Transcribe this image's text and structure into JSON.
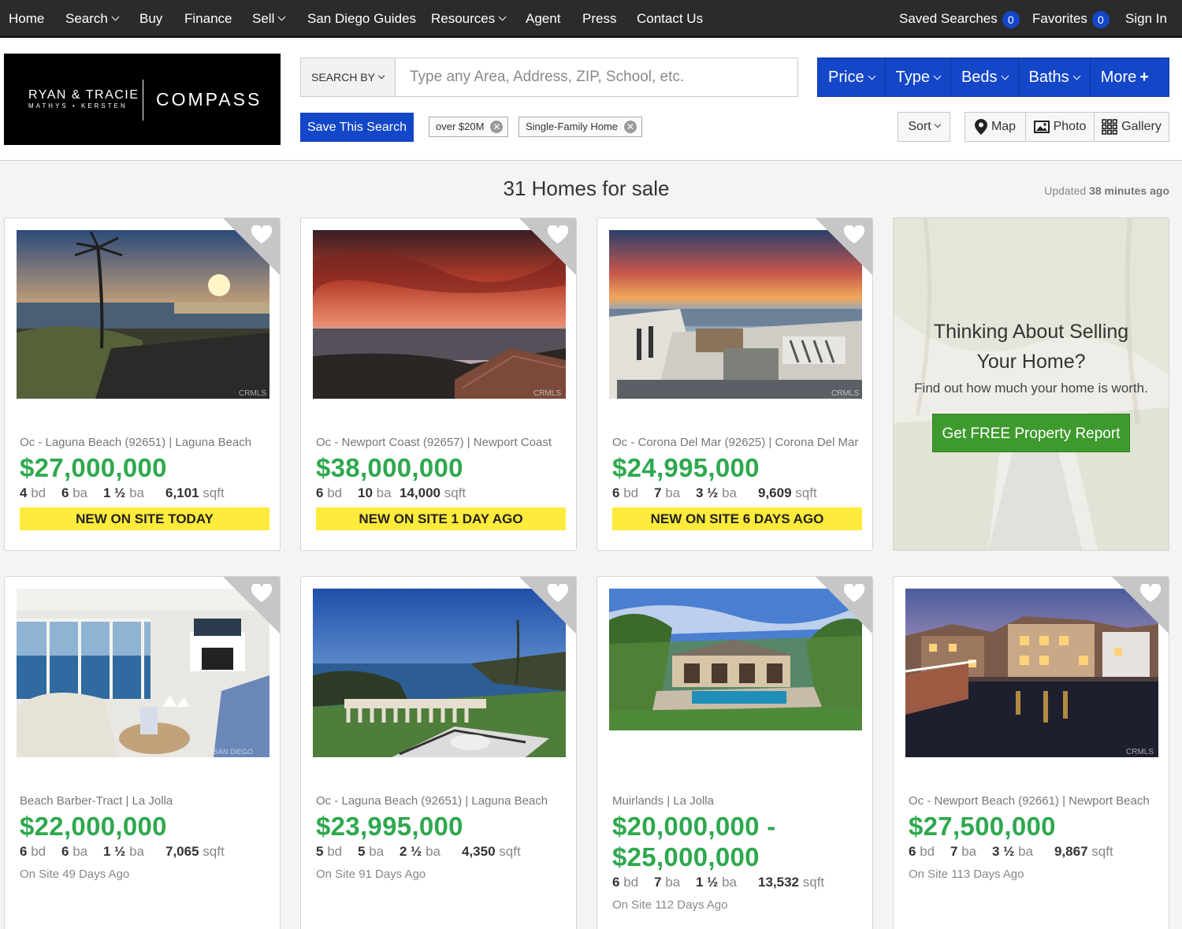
{
  "nav": {
    "home": "Home",
    "search": "Search",
    "buy": "Buy",
    "finance": "Finance",
    "sell": "Sell",
    "guides": "San Diego Guides",
    "resources": "Resources",
    "agent": "Agent",
    "press": "Press",
    "contact": "Contact Us",
    "saved_searches": "Saved Searches",
    "saved_count": "0",
    "favorites": "Favorites",
    "favorites_count": "0",
    "sign_in": "Sign In"
  },
  "logo": {
    "names": "RYAN & TRACIE",
    "surnames": "MATHYS • KERSTEN",
    "brand": "COMPASS"
  },
  "search": {
    "search_by": "SEARCH BY",
    "placeholder": "Type any Area, Address, ZIP, School, etc.",
    "save_label": "Save This Search"
  },
  "filters": {
    "price": "Price",
    "type": "Type",
    "beds": "Beds",
    "baths": "Baths",
    "more": "More"
  },
  "chips": [
    "over $20M",
    "Single-Family Home"
  ],
  "sort_label": "Sort",
  "views": {
    "map": "Map",
    "photo": "Photo",
    "gallery": "Gallery"
  },
  "results": {
    "title": "31 Homes for sale",
    "updated_prefix": "Updated",
    "updated_value": "38 minutes ago"
  },
  "listings": [
    {
      "area": "Oc - Laguna Beach (92651) | Laguna Beach",
      "price": "$27,000,000",
      "bd": "4",
      "ba": "6",
      "half": "1 ½",
      "sqft": "6,101",
      "badge": "NEW ON SITE TODAY",
      "onsite": ""
    },
    {
      "area": "Oc - Newport Coast (92657) | Newport Coast",
      "price": "$38,000,000",
      "bd": "6",
      "ba": "10",
      "half": "",
      "sqft": "14,000",
      "badge": "NEW ON SITE 1 DAY AGO",
      "onsite": ""
    },
    {
      "area": "Oc - Corona Del Mar (92625) | Corona Del Mar",
      "price": "$24,995,000",
      "bd": "6",
      "ba": "7",
      "half": "3 ½",
      "sqft": "9,609",
      "badge": "NEW ON SITE 6 DAYS AGO",
      "onsite": ""
    },
    {
      "area": "Beach Barber-Tract | La Jolla",
      "price": "$22,000,000",
      "bd": "6",
      "ba": "6",
      "half": "1 ½",
      "sqft": "7,065",
      "badge": "",
      "onsite": "On Site 49 Days Ago"
    },
    {
      "area": "Oc - Laguna Beach (92651) | Laguna Beach",
      "price": "$23,995,000",
      "bd": "5",
      "ba": "5",
      "half": "2 ½",
      "sqft": "4,350",
      "badge": "",
      "onsite": "On Site 91 Days Ago"
    },
    {
      "area": "Muirlands | La Jolla",
      "price": "$20,000,000 -",
      "price2": "$25,000,000",
      "bd": "6",
      "ba": "7",
      "half": "1 ½",
      "sqft": "13,532",
      "badge": "",
      "onsite": "On Site 112 Days Ago"
    },
    {
      "area": "Oc - Newport Beach (92661) | Newport Beach",
      "price": "$27,500,000",
      "bd": "6",
      "ba": "7",
      "half": "3 ½",
      "sqft": "9,867",
      "badge": "",
      "onsite": "On Site 113 Days Ago"
    }
  ],
  "units": {
    "bd": "bd",
    "ba": "ba",
    "sqft": "sqft"
  },
  "watermarks": {
    "crmls": "CRMLS",
    "sandiego": "SAN DIEGO"
  },
  "promo": {
    "line1": "Thinking About Selling",
    "line2": "Your Home?",
    "sub": "Find out how much your home is worth.",
    "cta": "Get FREE Property Report"
  },
  "colors": {
    "nav_bg": "#2b2b2b",
    "accent_blue": "#1446c8",
    "price_green": "#2fa84f",
    "badge_yellow": "#ffeb3b",
    "cta_green": "#3f9a2e"
  }
}
